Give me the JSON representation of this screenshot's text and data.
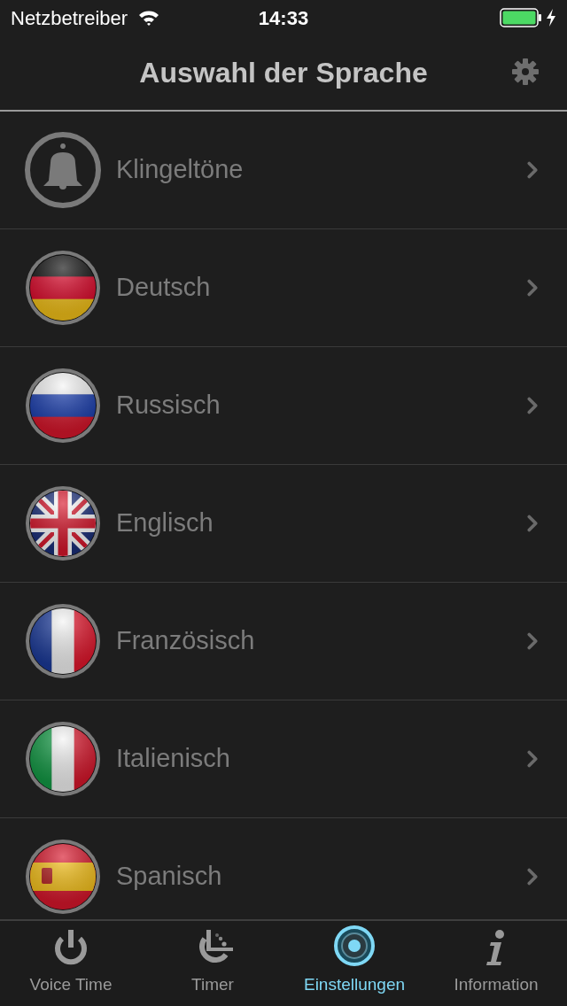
{
  "status_bar": {
    "carrier": "Netzbetreiber",
    "time": "14:33"
  },
  "nav": {
    "title": "Auswahl der Sprache"
  },
  "rows": [
    {
      "label": "Klingeltöne",
      "kind": "bell"
    },
    {
      "label": "Deutsch",
      "kind": "de"
    },
    {
      "label": "Russisch",
      "kind": "ru"
    },
    {
      "label": "Englisch",
      "kind": "gb"
    },
    {
      "label": "Französisch",
      "kind": "fr"
    },
    {
      "label": "Italienisch",
      "kind": "it"
    },
    {
      "label": "Spanisch",
      "kind": "es"
    }
  ],
  "tabs": [
    {
      "label": "Voice Time",
      "kind": "power",
      "selected": false
    },
    {
      "label": "Timer",
      "kind": "timer",
      "selected": false
    },
    {
      "label": "Einstellungen",
      "kind": "settings",
      "selected": true
    },
    {
      "label": "Information",
      "kind": "info",
      "selected": false
    }
  ]
}
